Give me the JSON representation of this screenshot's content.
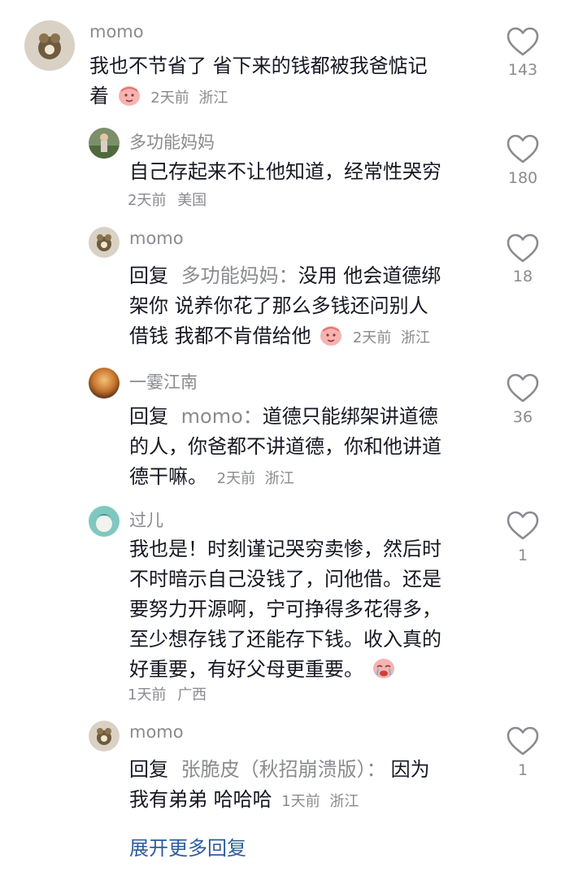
{
  "comments": [
    {
      "username": "momo",
      "text_lines": [
        "我也不节省了 省下来的钱都被我爸惦记",
        "着"
      ],
      "time": "2天前",
      "location": "浙江",
      "likes": "143"
    },
    {
      "username": "多功能妈妈",
      "text_lines": [
        "自己存起来不让他知道，经常性哭穷"
      ],
      "time": "2天前",
      "location": "美国",
      "likes": "180"
    },
    {
      "username": "momo",
      "reply_label": "回复",
      "reply_to": "多功能妈妈：",
      "text_lines": [
        "没用 他会道德绑",
        "架你 说养你花了那么多钱还问别人",
        "借钱 我都不肯借给他"
      ],
      "time": "2天前",
      "location": "浙江",
      "likes": "18"
    },
    {
      "username": "一霎江南",
      "reply_label": "回复",
      "reply_to": "momo：",
      "text_lines": [
        "道德只能绑架讲道德",
        "的人，你爸都不讲道德，你和他讲道",
        "德干嘛。"
      ],
      "time": "2天前",
      "location": "浙江",
      "likes": "36"
    },
    {
      "username": "过儿",
      "text_lines": [
        "我也是！时刻谨记哭穷卖惨，然后时",
        "不时暗示自己没钱了，问他借。还是",
        "要努力开源啊，宁可挣得多花得多，",
        "至少想存钱了还能存下钱。收入真的",
        "好重要，有好父母更重要。"
      ],
      "time": "1天前",
      "location": "广西",
      "likes": "1"
    },
    {
      "username": "momo",
      "reply_label": "回复",
      "reply_to": "张脆皮（秋招崩溃版）：",
      "text_lines": [
        "因为",
        "我有弟弟 哈哈哈"
      ],
      "time": "1天前",
      "location": "浙江",
      "likes": "1"
    }
  ],
  "expand_more": "展开更多回复",
  "icons": {
    "like": "heart-outline-icon",
    "emoji_sheep": "sheep-sticker-icon",
    "emoji_cry": "crying-face-icon"
  },
  "colors": {
    "username": "#8a8b91",
    "text": "#161823",
    "link": "#2d5c9e"
  }
}
